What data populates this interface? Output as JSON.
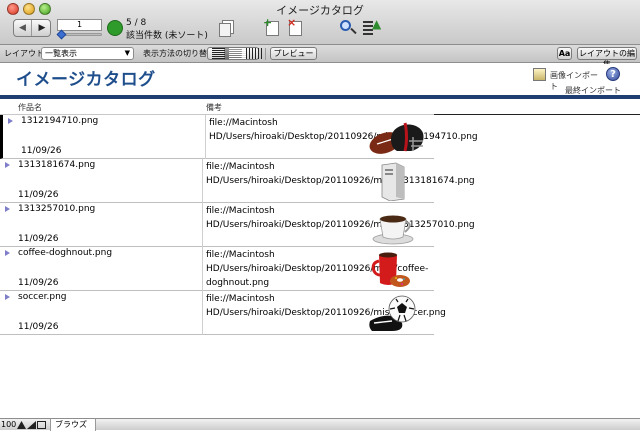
{
  "window": {
    "title": "イメージカタログ"
  },
  "toolbar": {
    "record_input": "1",
    "record_count": "5 / 8",
    "record_status": "該当件数 (未ソート)"
  },
  "layout_bar": {
    "layout_label": "レイアウト:",
    "layout_value": "一覧表示",
    "view_label": "表示方法の切り替え:",
    "preview_label": "プレビュー",
    "aa_label": "Aa",
    "edit_layout_label": "レイアウトの編集"
  },
  "header": {
    "title": "イメージカタログ",
    "import_label": "画像インポート",
    "help_label": "?",
    "last_import_label": "最終インポート"
  },
  "columns": {
    "name": "作品名",
    "note": "備考"
  },
  "rows": [
    {
      "name": "1312194710.png",
      "date": "11/09/26",
      "note": "file://Macintosh HD/Users/hiroaki/Desktop/20110926/misc/1312194710.png",
      "thumb": "helmet-football-image"
    },
    {
      "name": "1313181674.png",
      "date": "11/09/26",
      "note": "file://Macintosh HD/Users/hiroaki/Desktop/20110926/misc/1313181674.png",
      "thumb": "server-tower-image"
    },
    {
      "name": "1313257010.png",
      "date": "11/09/26",
      "note": "file://Macintosh HD/Users/hiroaki/Desktop/20110926/misc/1313257010.png",
      "thumb": "coffee-cup-image"
    },
    {
      "name": "coffee-doghnout.png",
      "date": "11/09/26",
      "note": "file://Macintosh HD/Users/hiroaki/Desktop/20110926/misc/coffee-doghnout.png",
      "thumb": "mug-donut-image"
    },
    {
      "name": "soccer.png",
      "date": "11/09/26",
      "note": "file://Macintosh HD/Users/hiroaki/Desktop/20110926/misc/soccer.png",
      "thumb": "soccer-ball-cleat-image"
    }
  ],
  "statusbar": {
    "zoom": "100",
    "mode": "ブラウズ"
  },
  "colors": {
    "title_blue": "#1f4e8c",
    "band": "#1f3f72",
    "row_marker": "#7f7fc9"
  }
}
